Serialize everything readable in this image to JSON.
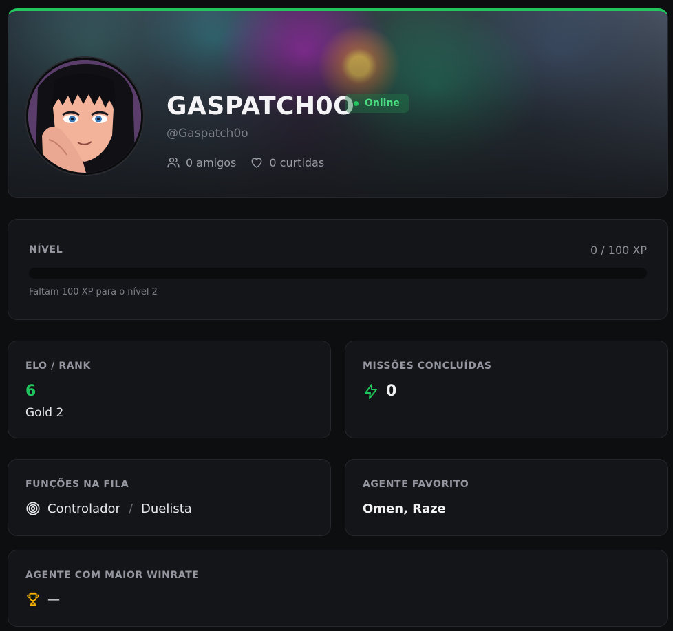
{
  "profile": {
    "username": "GASPATCH0O",
    "status": "Online",
    "handle": "@Gaspatch0o",
    "friends": "0 amigos",
    "likes": "0 curtidas",
    "avatar_icon": "avatar-portrait",
    "accent": "#22c55e"
  },
  "level": {
    "label": "NÍVEL",
    "xp": "0 / 100 XP",
    "progress_fraction": 0,
    "hint": "Faltam 100 XP para o nível 2"
  },
  "elo": {
    "label": "ELO / RANK",
    "value": "6",
    "rank": "Gold 2"
  },
  "missions": {
    "label": "MISSÕES CONCLUÍDAS",
    "icon": "lightning-icon",
    "value": "0"
  },
  "roles": {
    "label": "FUNÇÕES NA FILA",
    "icon": "target-icon",
    "items": [
      "Controlador",
      "Duelista"
    ],
    "separator": "/"
  },
  "favorite_agent": {
    "label": "AGENTE FAVORITO",
    "value": "Omen, Raze"
  },
  "top_winrate": {
    "label": "AGENTE COM MAIOR WINRATE",
    "icon": "trophy-icon",
    "value": "—"
  }
}
